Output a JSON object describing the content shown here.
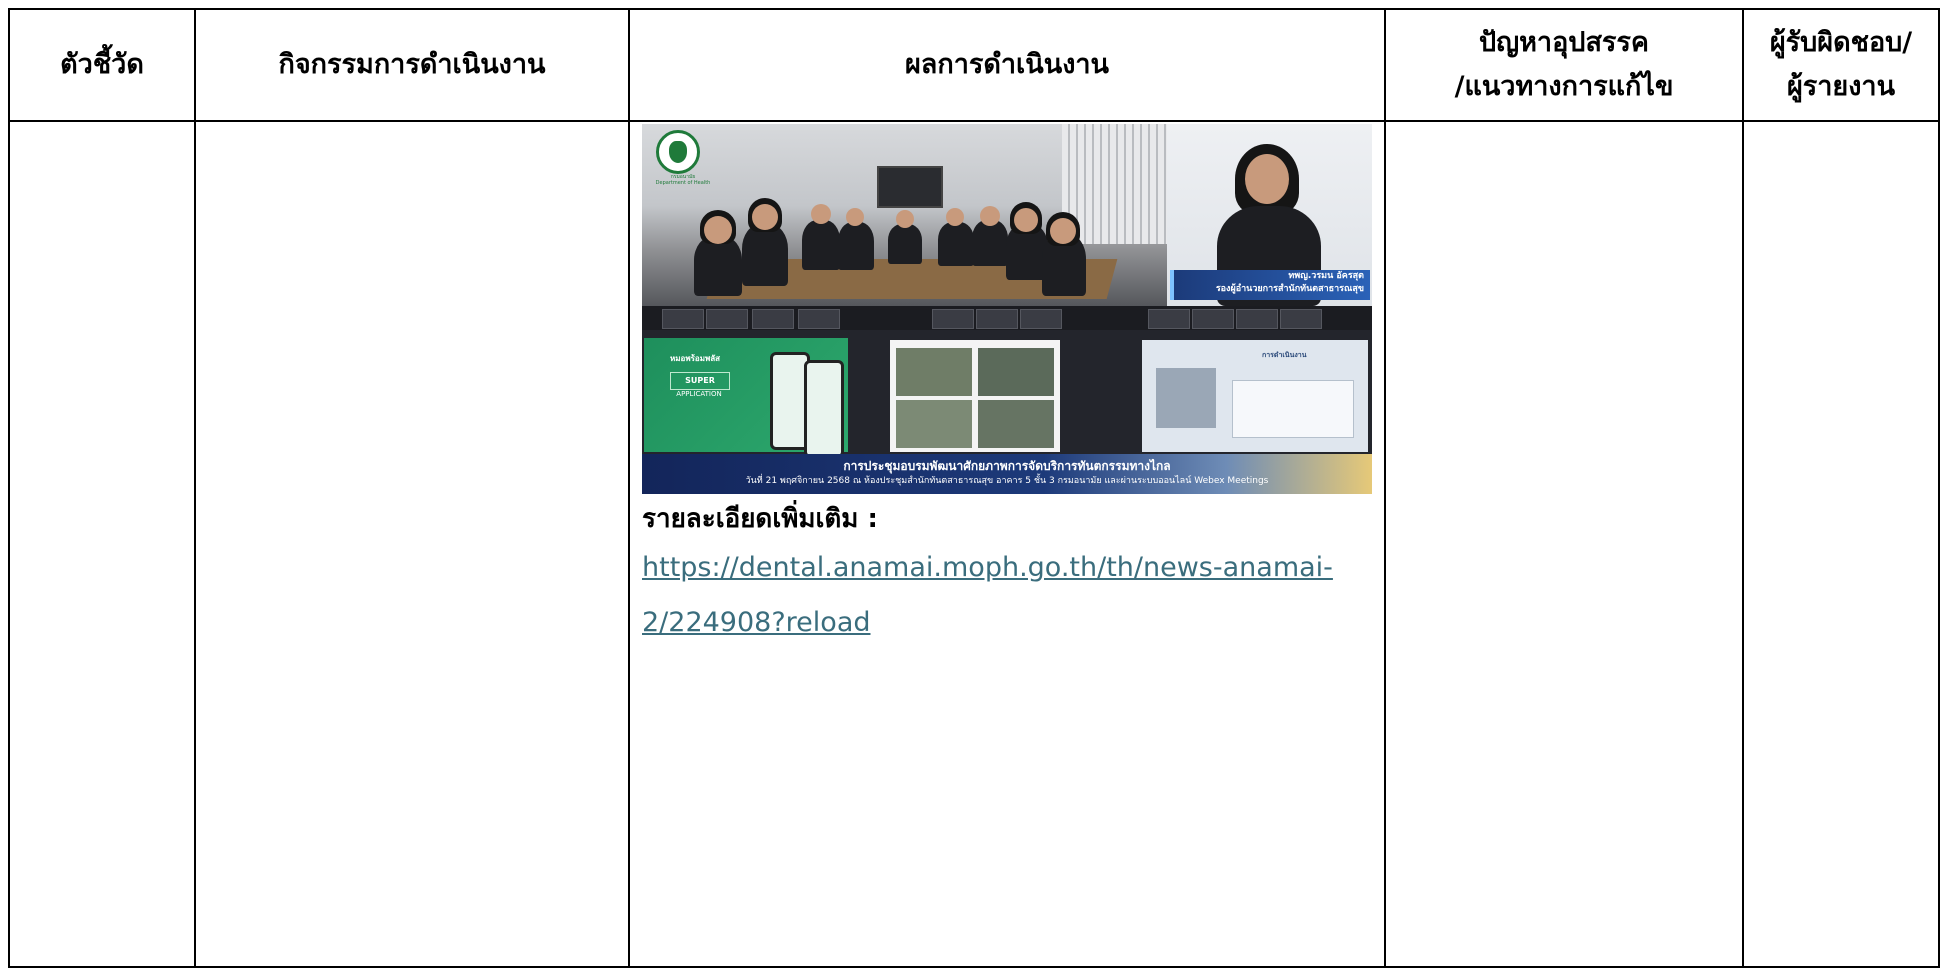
{
  "table": {
    "headers": [
      "ตัวชี้วัด",
      "กิจกรรมการดำเนินงาน",
      "ผลการดำเนินงาน",
      "ปัญหาอุปสรรค\n/แนวทางการแก้ไข",
      "ผู้รับผิดชอบ/\nผู้รายงาน"
    ],
    "header_col4_line1": "ปัญหาอุปสรรค",
    "header_col4_line2": "/แนวทางการแก้ไข",
    "header_col5_line1": "ผู้รับผิดชอบ/",
    "header_col5_line2": "ผู้รายงาน"
  },
  "result": {
    "photo": {
      "logo_text_th": "กรมอนามัย",
      "logo_text_en": "Department of Health",
      "speaker_name": "ทพญ.วรมน อัครสุต",
      "speaker_title": "รองผู้อำนวยการสำนักทันตสาธารณสุข",
      "app_label_th": "หมอพร้อมพลัส",
      "app_label_super": "SUPER",
      "app_label_application": "APPLICATION",
      "banner_title": "การประชุมอบรมพัฒนาศักยภาพการจัดบริการทันตกรรมทางไกล",
      "banner_subtitle": "วันที่ 21 พฤศจิกายน 2568 ณ ห้องประชุมสำนักทันตสาธารณสุข อาคาร 5 ชั้น 3 กรมอนามัย และผ่านระบบออนไลน์ Webex Meetings",
      "screen_right_label": "การดำเนินงาน"
    },
    "more_label": "รายละเอียดเพิ่มเติม :",
    "link_line1": "https://dental.anamai.moph.go.th/th/news-anamai-",
    "link_line2": "2/224908?reload"
  }
}
